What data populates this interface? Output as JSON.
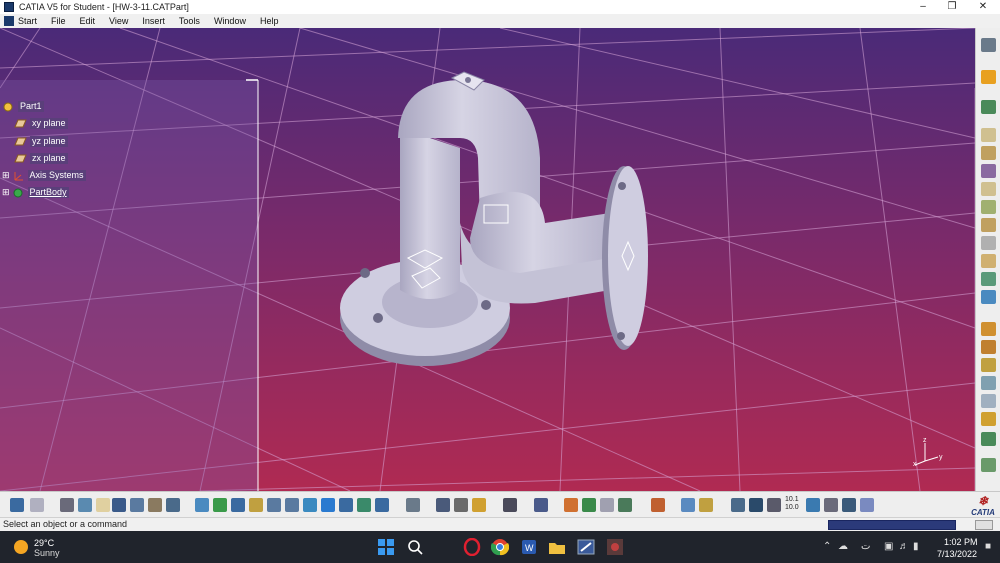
{
  "window": {
    "title": "CATIA V5 for Student - [HW-3-11.CATPart]"
  },
  "menu": [
    "Start",
    "File",
    "Edit",
    "View",
    "Insert",
    "Tools",
    "Window",
    "Help"
  ],
  "tree": {
    "root": "Part1",
    "items": [
      "xy plane",
      "yz plane",
      "zx plane",
      "Axis Systems",
      "PartBody"
    ]
  },
  "compass": {
    "z": "z",
    "x": "x",
    "y": "y"
  },
  "status": {
    "message": "Select an object or a command"
  },
  "bottom_toolbar": {
    "scale_label_top": "10.1",
    "scale_label_bottom": "10.0"
  },
  "brand": {
    "logo": "CATIA"
  },
  "weather": {
    "temp": "29°C",
    "condition": "Sunny"
  },
  "clock": {
    "time": "1:02 PM",
    "date": "7/13/2022"
  },
  "colors": {
    "viewport_top": "#4a2a78",
    "viewport_bottom": "#b02a52",
    "part": "#c8c6d8",
    "tree_highlight": "#5a3f7a"
  }
}
